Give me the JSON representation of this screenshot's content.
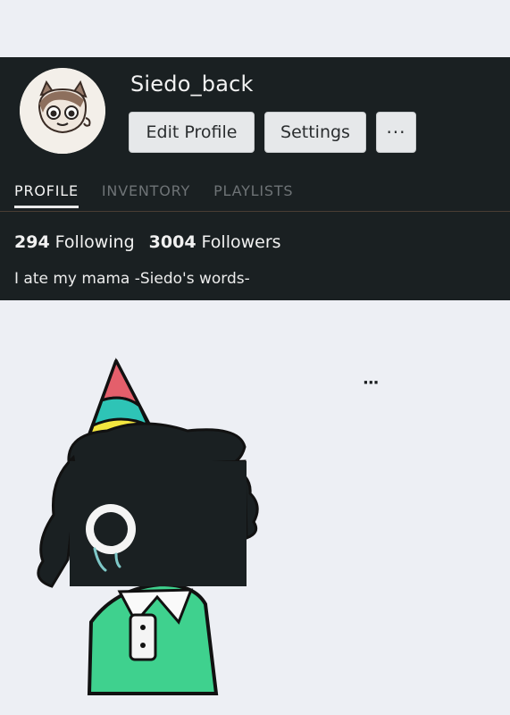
{
  "profile": {
    "username": "Siedo_back",
    "bio": "I ate my mama -Siedo's words-",
    "following_count": "294",
    "following_label": "Following",
    "followers_count": "3004",
    "followers_label": "Followers"
  },
  "buttons": {
    "edit_profile": "Edit Profile",
    "settings": "Settings",
    "more": "···"
  },
  "tabs": [
    {
      "label": "PROFILE",
      "active": true
    },
    {
      "label": "INVENTORY",
      "active": false
    },
    {
      "label": "PLAYLISTS",
      "active": false
    }
  ],
  "post": {
    "more_label": "···"
  },
  "colors": {
    "header_bg": "#1a2022",
    "page_bg": "#edeff4",
    "button_bg": "#e6e8ea",
    "hat_yellow": "#f3e63f",
    "hat_teal": "#2ec4b6",
    "hat_red": "#e45f6b",
    "shirt_green": "#3fd18e"
  },
  "icons": {
    "avatar": "cat-character-avatar",
    "more": "ellipsis-icon"
  }
}
